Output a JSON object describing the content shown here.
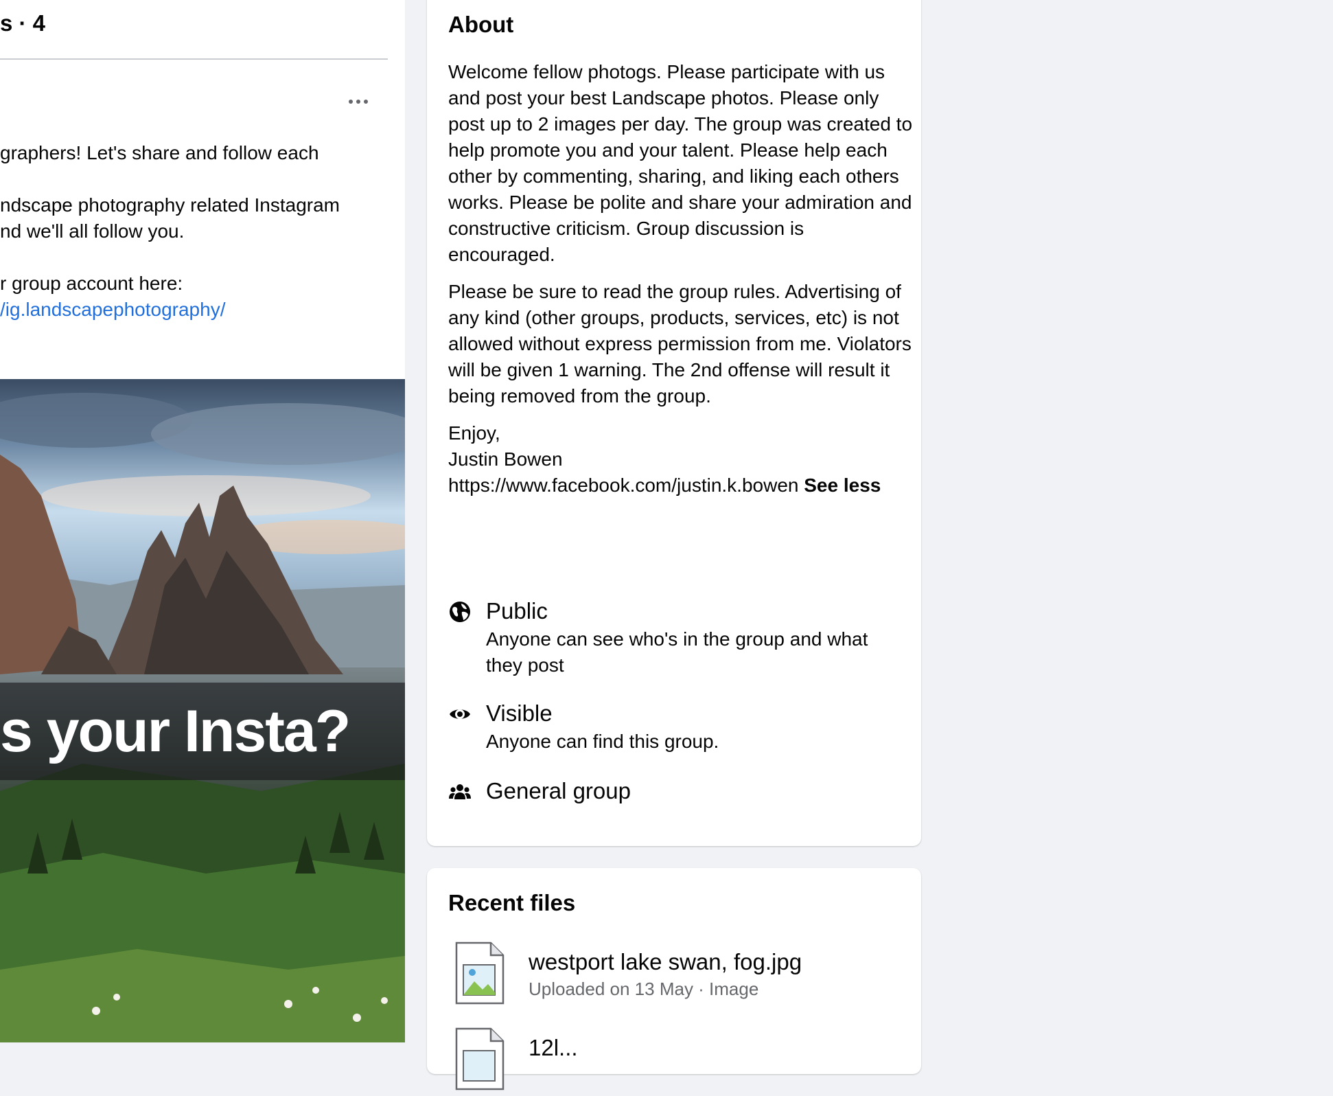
{
  "feed": {
    "featured_title": "s · 4",
    "post_text": {
      "line1": "graphers! Let's share and follow each",
      "line2": "",
      "line3": "ndscape photography related Instagram",
      "line4": "nd we'll all follow you.",
      "line5": "r group account here:",
      "link": "/ig.landscapephotography/"
    },
    "image_banner_text": "s your Insta?"
  },
  "about": {
    "title": "About",
    "description": [
      "Welcome fellow photogs. Please participate with us and post your best Landscape photos. Please only post up to 2 images per day. The group was created to help promote you and your talent. Please help each other by commenting, sharing, and liking each others works. Please be polite and share your admiration and constructive criticism. Group discussion is encouraged.",
      "Please be sure to read the group rules. Advertising of any kind (other groups, products, services, etc) is not allowed without express permission from me. Violators will be given 1 warning. The 2nd offense will result it being removed from the group."
    ],
    "signoff": {
      "line1": "Enjoy,",
      "line2": "Justin Bowen",
      "line3": "https://www.facebook.com/justin.k.bowen",
      "see_less": "See less"
    },
    "privacy": {
      "icon": "globe-icon",
      "title": "Public",
      "subtitle": "Anyone can see who's in the group and what they post"
    },
    "visibility": {
      "icon": "eye-icon",
      "title": "Visible",
      "subtitle": "Anyone can find this group."
    },
    "group_type": {
      "icon": "people-icon",
      "title": "General group"
    }
  },
  "recent_files": {
    "title": "Recent files",
    "files": [
      {
        "name": "westport lake swan, fog.jpg",
        "meta": "Uploaded on 13 May · Image",
        "icon": "image-file-icon"
      },
      {
        "name": "12l...",
        "meta": "",
        "icon": "image-file-icon"
      }
    ]
  },
  "colors": {
    "page_background": "#f0f2f5",
    "card_background": "#ffffff",
    "link": "#216fdb",
    "secondary_text": "#65676b"
  }
}
